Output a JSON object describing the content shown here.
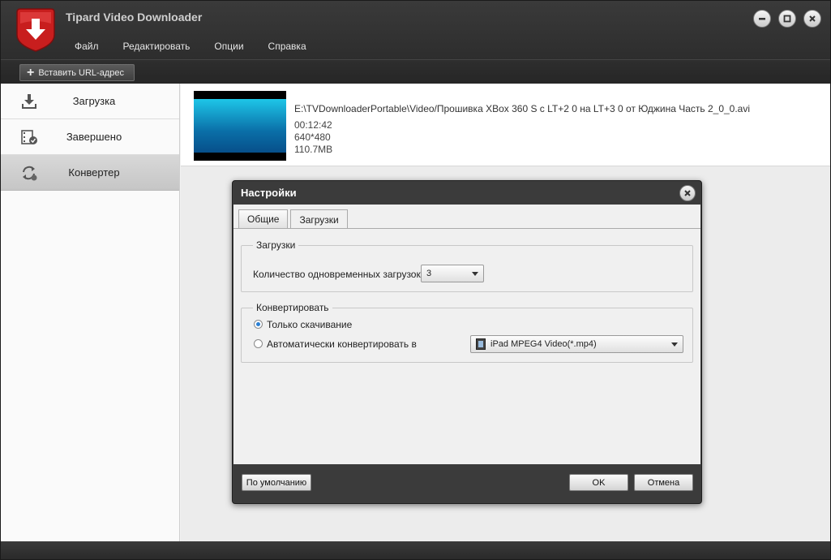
{
  "app": {
    "title": "Tipard Video Downloader"
  },
  "menu": [
    "Файл",
    "Редактировать",
    "Опции",
    "Справка"
  ],
  "toolbar": {
    "paste_url_label": "Вставить URL-адрес"
  },
  "sidebar": {
    "items": [
      {
        "label": "Загрузка",
        "icon": "download-icon"
      },
      {
        "label": "Завершено",
        "icon": "film-check-icon"
      },
      {
        "label": "Конвертер",
        "icon": "convert-icon",
        "active": true
      }
    ]
  },
  "file": {
    "path": "E:\\TVDownloaderPortable\\Video/Прошивка XBox 360 S c LT+2 0 на LT+3 0 от Юджина Часть 2_0_0.avi",
    "duration": "00:12:42",
    "resolution": "640*480",
    "size": "110.7MB"
  },
  "dialog": {
    "title": "Настройки",
    "tabs": [
      "Общие",
      "Загрузки"
    ],
    "active_tab": "Загрузки",
    "downloads_group": {
      "label": "Загрузки",
      "concurrent_label": "Количество одновременных загрузок:",
      "concurrent_value": "3"
    },
    "convert_group": {
      "label": "Конвертировать",
      "option_download_only": "Только скачивание",
      "option_auto_convert": "Автоматически конвертировать в",
      "selected_option": "download_only",
      "format_value": "iPad MPEG4 Video(*.mp4)"
    },
    "buttons": {
      "defaults": "По умолчанию",
      "ok": "OK",
      "cancel": "Отмена"
    }
  },
  "colors": {
    "accent": "#2a7fd4",
    "title_bg": "#333333",
    "logo_red": "#d42a2a"
  }
}
